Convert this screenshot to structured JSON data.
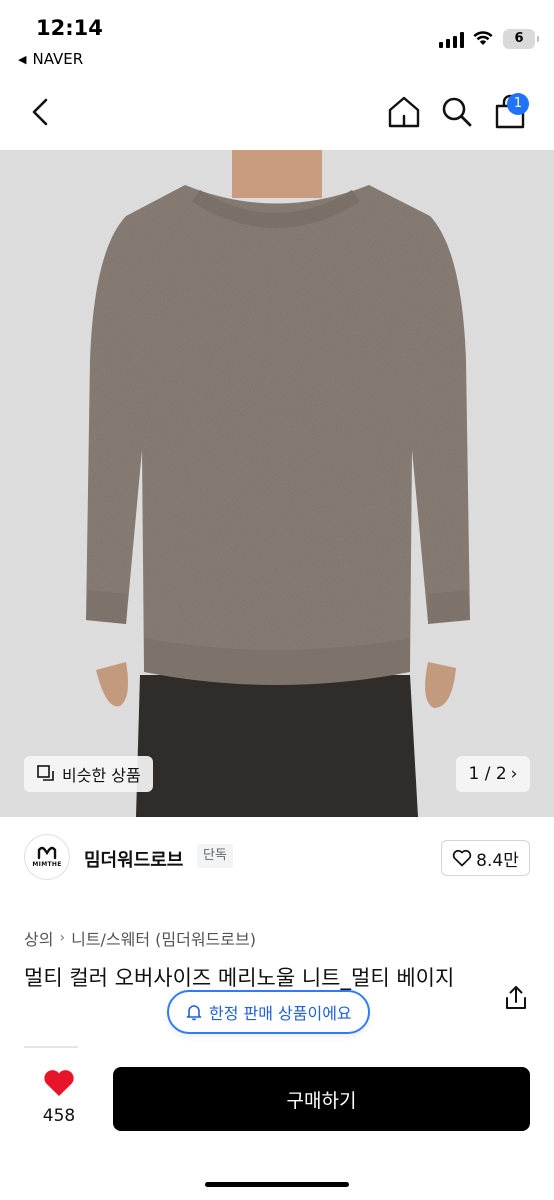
{
  "status_bar": {
    "time": "12:14",
    "back_app": "NAVER",
    "battery": "6"
  },
  "header": {
    "cart_badge": "1",
    "icons": [
      "back-icon",
      "home-icon",
      "search-icon",
      "shopping-bag-icon"
    ]
  },
  "gallery": {
    "similar_label": "비슷한 상품",
    "pager": "1 / 2",
    "colors": {
      "sweater": "#8a7f76",
      "background": "#dcdcdc",
      "pants": "#2f2c2a"
    }
  },
  "store": {
    "logo_text": "MIMTHE",
    "name": "밈더워드로브",
    "badge": "단독",
    "wish_count": "8.4만"
  },
  "breadcrumb": {
    "level1": "상의",
    "level2": "니트/스웨터 (밈더워드로브)"
  },
  "product": {
    "title": "멀티 컬러 오버사이즈 메리노울 니트_멀티 베이지"
  },
  "notice": {
    "text": "한정 판매 상품이에요"
  },
  "bottom_bar": {
    "like_count": "458",
    "buy_label": "구매하기"
  },
  "accent": {
    "like": "#e8142a",
    "notice": "#2f7bff",
    "badge": "#1f73ff"
  }
}
